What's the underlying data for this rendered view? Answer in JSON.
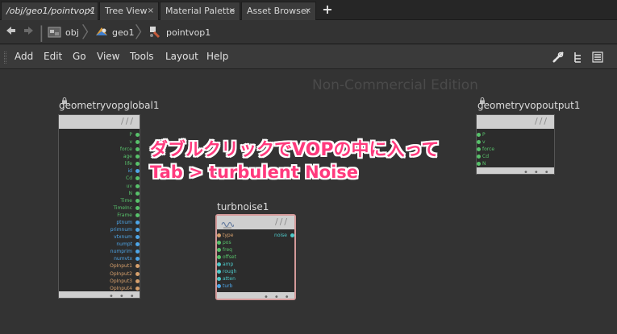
{
  "tabs": [
    {
      "label": "/obj/geo1/pointvop1",
      "active": true
    },
    {
      "label": "Tree View",
      "active": false
    },
    {
      "label": "Material Palette",
      "active": false
    },
    {
      "label": "Asset Browser",
      "active": false
    }
  ],
  "tab_close_glyph": "×",
  "tab_add_glyph": "+",
  "path": {
    "obj": "obj",
    "geo": "geo1",
    "vop": "pointvop1"
  },
  "menu": [
    "Add",
    "Edit",
    "Go",
    "View",
    "Tools",
    "Layout",
    "Help"
  ],
  "watermark": "Non-Commercial Edition",
  "nodes": {
    "global": {
      "name": "geometryvopglobal1",
      "outputs": [
        {
          "label": "P",
          "color": "#58c26b"
        },
        {
          "label": "v",
          "color": "#58c26b"
        },
        {
          "label": "force",
          "color": "#58c26b"
        },
        {
          "label": "age",
          "color": "#58c26b"
        },
        {
          "label": "life",
          "color": "#58c26b"
        },
        {
          "label": "id",
          "color": "#4ea6e8"
        },
        {
          "label": "Cd",
          "color": "#58c26b"
        },
        {
          "label": "uv",
          "color": "#58c26b"
        },
        {
          "label": "N",
          "color": "#58c26b"
        },
        {
          "label": "Time",
          "color": "#58c26b"
        },
        {
          "label": "TimeInc",
          "color": "#58c26b"
        },
        {
          "label": "Frame",
          "color": "#58c26b"
        },
        {
          "label": "ptnum",
          "color": "#4ea6e8"
        },
        {
          "label": "primnum",
          "color": "#4ea6e8"
        },
        {
          "label": "vtxnum",
          "color": "#4ea6e8"
        },
        {
          "label": "numpt",
          "color": "#4ea6e8"
        },
        {
          "label": "numprim",
          "color": "#4ea6e8"
        },
        {
          "label": "numvtx",
          "color": "#4ea6e8"
        },
        {
          "label": "OpInput1",
          "color": "#d7a06c"
        },
        {
          "label": "OpInput2",
          "color": "#d7a06c"
        },
        {
          "label": "OpInput3",
          "color": "#d7a06c"
        },
        {
          "label": "OpInput4",
          "color": "#d7a06c"
        }
      ]
    },
    "output": {
      "name": "geometryvopoutput1",
      "inputs": [
        {
          "label": "P",
          "color": "#58c26b"
        },
        {
          "label": "v",
          "color": "#58c26b"
        },
        {
          "label": "force",
          "color": "#58c26b"
        },
        {
          "label": "Cd",
          "color": "#58c26b"
        },
        {
          "label": "N",
          "color": "#58c26b"
        }
      ]
    },
    "turb": {
      "name": "turbnoise1",
      "inputs": [
        {
          "label": "type",
          "color": "#d7a06c"
        },
        {
          "label": "pos",
          "color": "#58c26b"
        },
        {
          "label": "freq",
          "color": "#58c26b"
        },
        {
          "label": "offset",
          "color": "#58c26b"
        },
        {
          "label": "amp",
          "color": "#4ec9c9"
        },
        {
          "label": "rough",
          "color": "#4ec9c9"
        },
        {
          "label": "atten",
          "color": "#4ec9c9"
        },
        {
          "label": "turb",
          "color": "#4ea6e8"
        }
      ],
      "outputs": [
        {
          "label": "noise",
          "color": "#4ec9c9"
        }
      ]
    }
  },
  "annotation": {
    "line1": "ダブルクリックでVOPの中に入って",
    "line2": "Tab > turbulent Noise",
    "color": "#ff3a7d"
  }
}
